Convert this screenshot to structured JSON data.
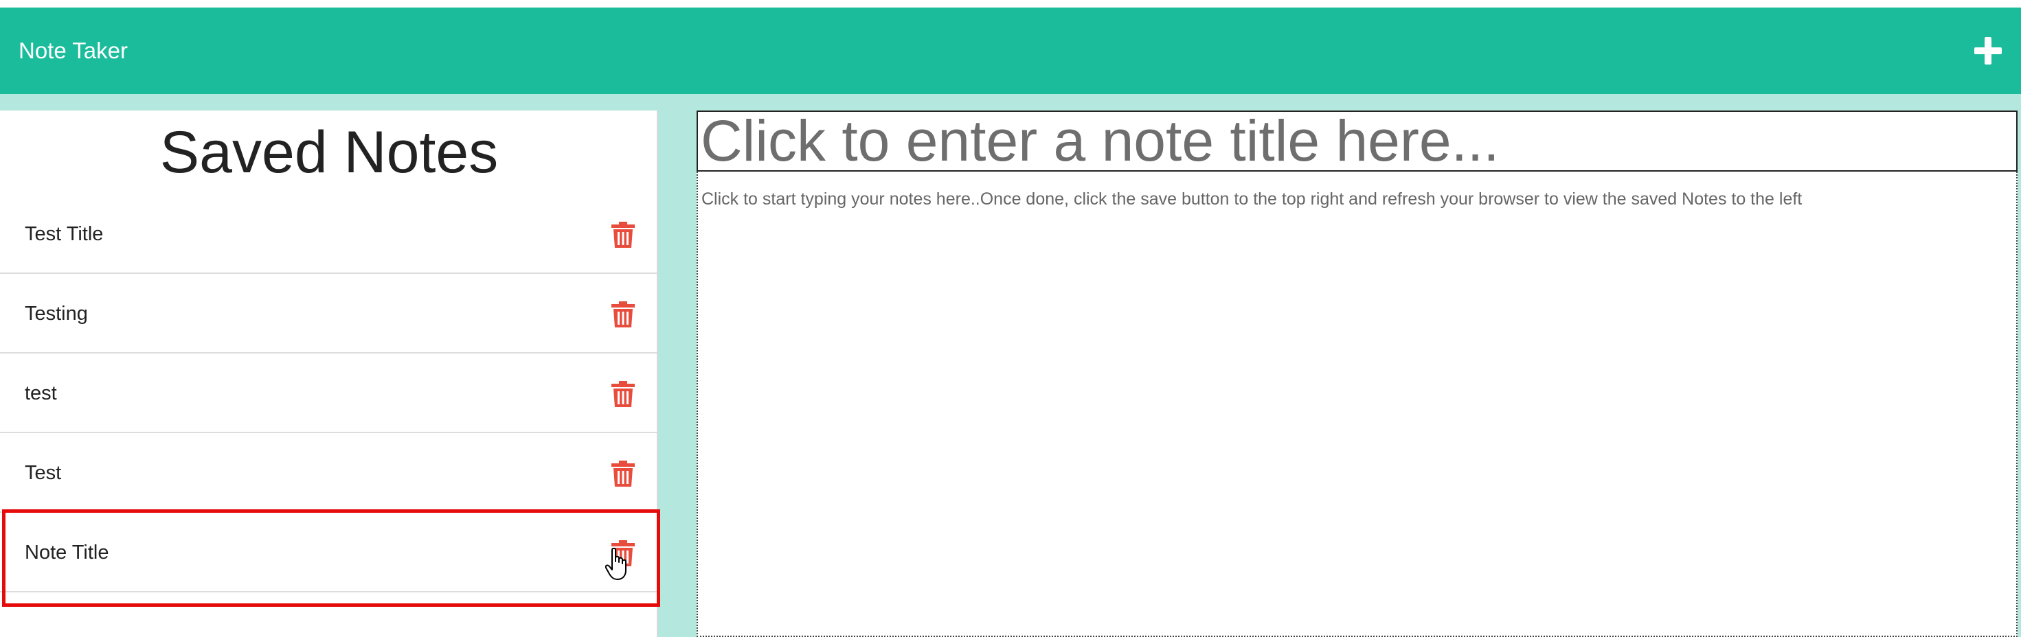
{
  "navbar": {
    "brand": "Note Taker",
    "new_note_icon": "plus-icon"
  },
  "sidebar": {
    "title": "Saved Notes",
    "notes": [
      {
        "title": "Test Title",
        "delete_icon": "trash-icon"
      },
      {
        "title": "Testing",
        "delete_icon": "trash-icon"
      },
      {
        "title": "test",
        "delete_icon": "trash-icon"
      },
      {
        "title": "Test",
        "delete_icon": "trash-icon"
      },
      {
        "title": "Note Title",
        "delete_icon": "trash-icon"
      }
    ]
  },
  "editor": {
    "title_placeholder": "Click to enter a note title here...",
    "body_placeholder": "Click to start typing your notes here..Once done, click the save button to the top right and refresh your browser to view the saved Notes to the left"
  },
  "colors": {
    "navbar": "#1abc9c",
    "background": "#b4e8df",
    "delete": "#e74c3c",
    "highlight": "#e60b0b"
  }
}
